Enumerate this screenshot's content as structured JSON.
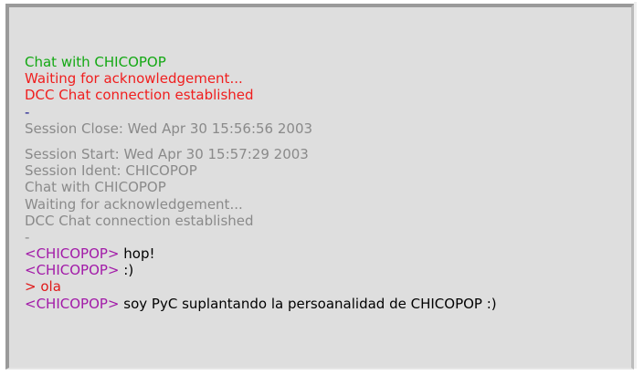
{
  "chat_log": {
    "block1": {
      "chat_with": "Chat with CHICOPOP",
      "waiting": "Waiting for acknowledgement...",
      "established": "DCC Chat connection established",
      "separator": "-",
      "session_close": "Session Close: Wed Apr 30 15:56:56 2003"
    },
    "block2": {
      "session_start": "Session Start: Wed Apr 30 15:57:29 2003",
      "session_ident": "Session Ident: CHICOPOP",
      "chat_with": "Chat with CHICOPOP",
      "waiting": "Waiting for acknowledgement...",
      "established": "DCC Chat connection established",
      "separator": "-"
    },
    "messages": [
      {
        "nick": "<CHICOPOP>",
        "text": " hop!"
      },
      {
        "nick": "<CHICOPOP>",
        "text": " :)"
      },
      {
        "nick": ">",
        "text": " ola"
      },
      {
        "nick": "<CHICOPOP>",
        "text": " soy PyC suplantando la persoanalidad de CHICOPOP :)"
      }
    ]
  },
  "colors": {
    "system_green": "#13a813",
    "system_red": "#f01e1e",
    "system_grey": "#8a8a8a",
    "nick_purple": "#a21aa8",
    "self_red": "#e01818",
    "background": "#dedede"
  }
}
